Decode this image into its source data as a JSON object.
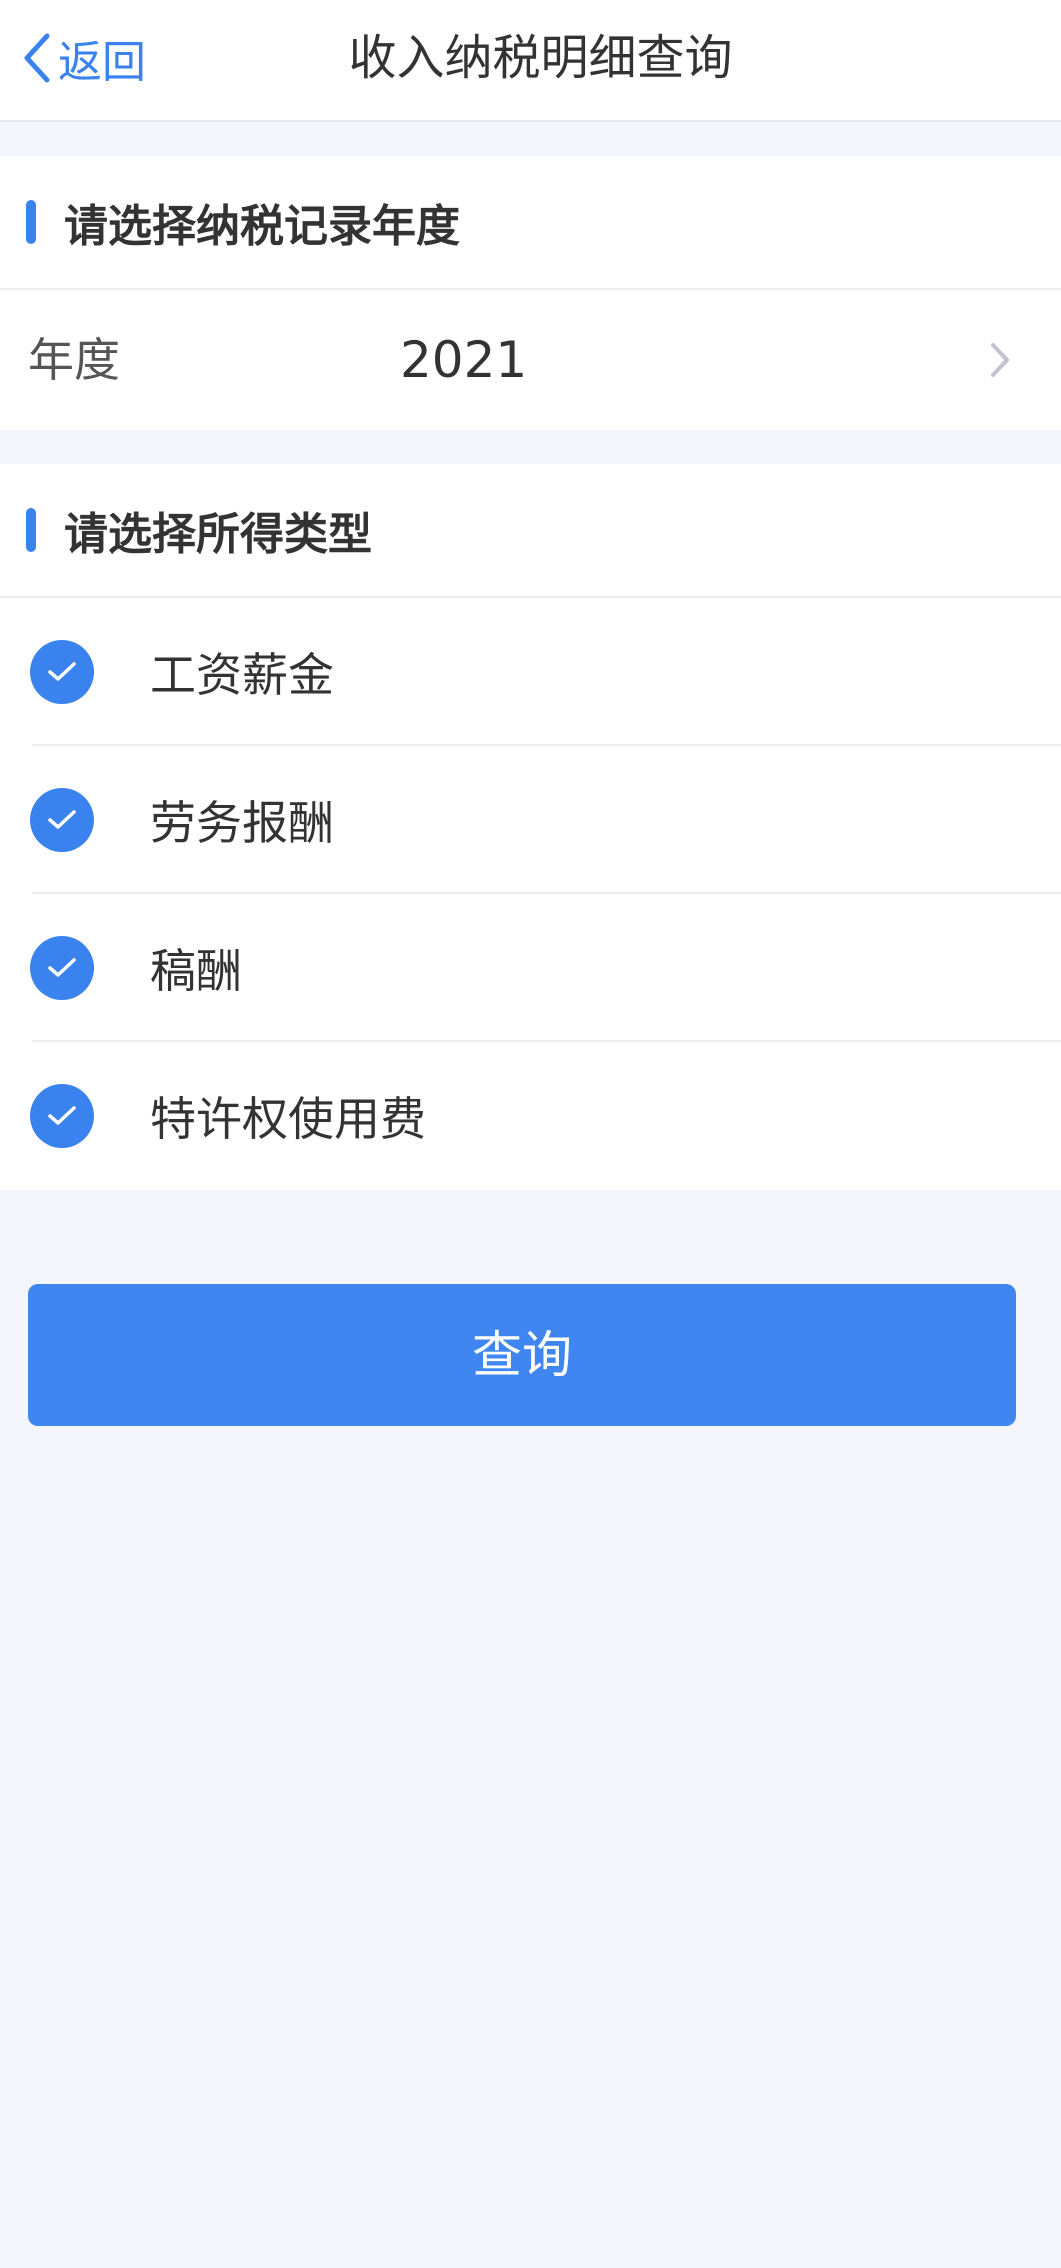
{
  "nav": {
    "back_label": "返回",
    "title": "收入纳税明细查询"
  },
  "year_section": {
    "title": "请选择纳税记录年度",
    "year_label": "年度",
    "year_value": "2021"
  },
  "income_section": {
    "title": "请选择所得类型",
    "options": [
      {
        "label": "工资薪金",
        "checked": true
      },
      {
        "label": "劳务报酬",
        "checked": true
      },
      {
        "label": "稿酬",
        "checked": true
      },
      {
        "label": "特许权使用费",
        "checked": true
      }
    ]
  },
  "query_button": {
    "label": "查询"
  },
  "colors": {
    "accent": "#3a82ee",
    "page_background": "#f4f6fb"
  },
  "icons": {
    "back": "chevron-left-icon",
    "year_arrow": "chevron-right-icon",
    "option_check": "check-circle-icon"
  }
}
